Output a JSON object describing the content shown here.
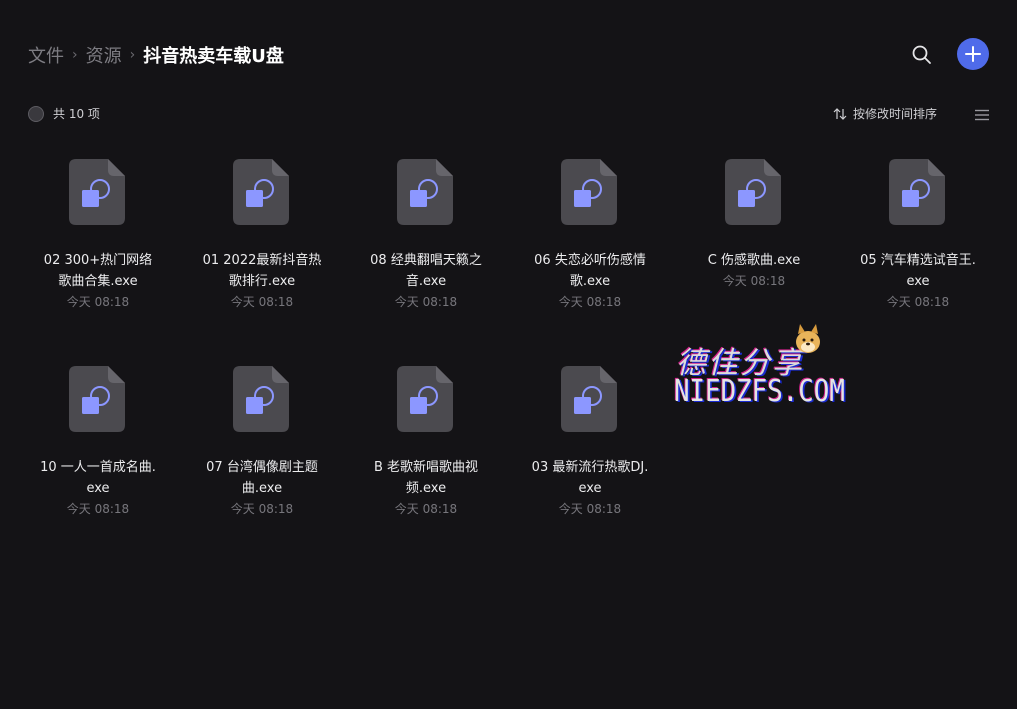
{
  "breadcrumb": {
    "items": [
      "文件",
      "资源",
      "抖音热卖车载U盘"
    ],
    "separator": "›"
  },
  "header": {
    "search_icon": "search-icon",
    "add_icon": "plus-icon",
    "add_color": "#4f6bea"
  },
  "toolbar": {
    "count_label": "共 10 项",
    "sort_label": "按修改时间排序",
    "sort_icon": "sort-arrows-icon",
    "view_icon": "list-view-icon"
  },
  "files": [
    {
      "name": "02 300+热门网络歌曲合集.exe",
      "time": "今天 08:18"
    },
    {
      "name": "01 2022最新抖音热歌排行.exe",
      "time": "今天 08:18"
    },
    {
      "name": "08 经典翻唱天籁之音.exe",
      "time": "今天 08:18"
    },
    {
      "name": "06 失恋必听伤感情歌.exe",
      "time": "今天 08:18"
    },
    {
      "name": "C 伤感歌曲.exe",
      "time": "今天 08:18"
    },
    {
      "name": "05 汽车精选试音王.exe",
      "time": "今天 08:18"
    },
    {
      "name": "10 一人一首成名曲.exe",
      "time": "今天 08:18"
    },
    {
      "name": "07 台湾偶像剧主题曲.exe",
      "time": "今天 08:18"
    },
    {
      "name": "B 老歌新唱歌曲视频.exe",
      "time": "今天 08:18"
    },
    {
      "name": "03 最新流行热歌DJ.exe",
      "time": "今天 08:18"
    }
  ],
  "watermark": {
    "cn": "德佳分享",
    "en": "NIEDZFS.COM"
  }
}
